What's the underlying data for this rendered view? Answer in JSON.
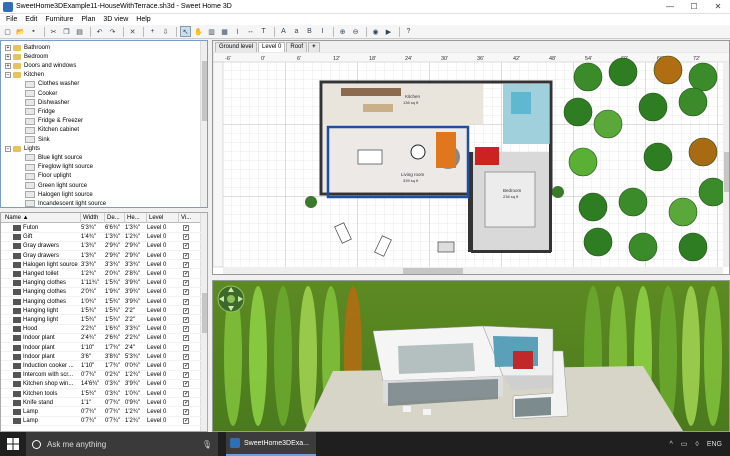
{
  "window": {
    "title": "SweetHome3DExample11-HouseWithTerrace.sh3d - Sweet Home 3D"
  },
  "menu": [
    "File",
    "Edit",
    "Furniture",
    "Plan",
    "3D view",
    "Help"
  ],
  "toolbar_icons": [
    "new-icon",
    "open-icon",
    "save-icon",
    "sep",
    "cut-icon",
    "copy-icon",
    "paste-icon",
    "sep",
    "undo-icon",
    "redo-icon",
    "sep",
    "delete-icon",
    "sep",
    "add-furniture-icon",
    "import-icon",
    "sep",
    "select-icon",
    "pan-icon",
    "create-walls-icon",
    "create-rooms-icon",
    "create-polylines-icon",
    "create-dimensions-icon",
    "create-labels-icon",
    "sep",
    "enlarge-text-icon",
    "reduce-text-icon",
    "bold-icon",
    "italic-icon",
    "sep",
    "zoom-in-icon",
    "zoom-out-icon",
    "sep",
    "create-photo-icon",
    "create-video-icon",
    "sep",
    "help-icon"
  ],
  "catalog": {
    "items": [
      {
        "label": "Bathroom",
        "level": 0,
        "kind": "folder",
        "expanded": false
      },
      {
        "label": "Bedroom",
        "level": 0,
        "kind": "folder",
        "expanded": false
      },
      {
        "label": "Doors and windows",
        "level": 0,
        "kind": "folder",
        "expanded": false
      },
      {
        "label": "Kitchen",
        "level": 0,
        "kind": "folder",
        "expanded": true
      },
      {
        "label": "Clothes washer",
        "level": 1,
        "kind": "item"
      },
      {
        "label": "Cooker",
        "level": 1,
        "kind": "item"
      },
      {
        "label": "Dishwasher",
        "level": 1,
        "kind": "item"
      },
      {
        "label": "Fridge",
        "level": 1,
        "kind": "item"
      },
      {
        "label": "Fridge & Freezer",
        "level": 1,
        "kind": "item"
      },
      {
        "label": "Kitchen cabinet",
        "level": 1,
        "kind": "item"
      },
      {
        "label": "Sink",
        "level": 1,
        "kind": "item"
      },
      {
        "label": "Lights",
        "level": 0,
        "kind": "folder",
        "expanded": true
      },
      {
        "label": "Blue light source",
        "level": 1,
        "kind": "item"
      },
      {
        "label": "Fireglow light source",
        "level": 1,
        "kind": "item"
      },
      {
        "label": "Floor uplight",
        "level": 1,
        "kind": "item"
      },
      {
        "label": "Green light source",
        "level": 1,
        "kind": "item"
      },
      {
        "label": "Halogen light source",
        "level": 1,
        "kind": "item"
      },
      {
        "label": "Incandescent light source",
        "level": 1,
        "kind": "item"
      }
    ]
  },
  "furniture": {
    "columns": [
      "Name ▲",
      "Width",
      "De...",
      "He...",
      "Level",
      "Vi..."
    ],
    "rows": [
      [
        "Futon",
        "5'3¾\"",
        "6'6¾\"",
        "1'3¾\"",
        "Level 0",
        "✓"
      ],
      [
        "Gift",
        "1'4¾\"",
        "1'3¾\"",
        "1'2¾\"",
        "Level 0",
        "✓"
      ],
      [
        "Gray drawers",
        "1'3¾\"",
        "2'9¾\"",
        "2'9¾\"",
        "Level 0",
        "✓"
      ],
      [
        "Gray drawers",
        "1'3¾\"",
        "2'9¾\"",
        "2'9¾\"",
        "Level 0",
        "✓"
      ],
      [
        "Halogen light source",
        "3'3¾\"",
        "3'3¾\"",
        "3'3¾\"",
        "Level 0",
        "✓"
      ],
      [
        "Hanged toilet",
        "1'2¾\"",
        "2'0¾\"",
        "2'8¾\"",
        "Level 0",
        "✓"
      ],
      [
        "Hanging clothes",
        "1'11¾\"",
        "1'5¾\"",
        "3'9¾\"",
        "Level 0",
        "✓"
      ],
      [
        "Hanging clothes",
        "2'0¾\"",
        "1'9¾\"",
        "3'9¾\"",
        "Level 0",
        "✓"
      ],
      [
        "Hanging clothes",
        "1'0¾\"",
        "1'5¾\"",
        "3'9¾\"",
        "Level 0",
        "✓"
      ],
      [
        "Hanging light",
        "1'5¾\"",
        "1'5¾\"",
        "2'2\"",
        "Level 0",
        "✓"
      ],
      [
        "Hanging light",
        "1'5¾\"",
        "1'5¾\"",
        "2'2\"",
        "Level 0",
        "✓"
      ],
      [
        "Hood",
        "2'2¾\"",
        "1'6¾\"",
        "3'3¾\"",
        "Level 0",
        "✓"
      ],
      [
        "Indoor plant",
        "2'4¾\"",
        "2'6¾\"",
        "2'2¾\"",
        "Level 0",
        "✓"
      ],
      [
        "Indoor plant",
        "1'10\"",
        "1'7¾\"",
        "2'4\"",
        "Level 0",
        "✓"
      ],
      [
        "Indoor plant",
        "3'6\"",
        "3'8¾\"",
        "5'3¾\"",
        "Level 0",
        "✓"
      ],
      [
        "Induction cooker ...",
        "1'10\"",
        "1'7¾\"",
        "0'0¾\"",
        "Level 0",
        "✓"
      ],
      [
        "Intercom with scr...",
        "0'7¾\"",
        "0'2¾\"",
        "1'2¾\"",
        "Level 0",
        "✓"
      ],
      [
        "Kitchen shop win...",
        "14'6¾\"",
        "0'3¾\"",
        "3'9¾\"",
        "Level 0",
        "✓"
      ],
      [
        "Kitchen tools",
        "1'5¾\"",
        "0'3¾\"",
        "1'0¾\"",
        "Level 0",
        "✓"
      ],
      [
        "Knife stand",
        "1'1\"",
        "0'7¾\"",
        "0'9¾\"",
        "Level 0",
        "✓"
      ],
      [
        "Lamp",
        "0'7¾\"",
        "0'7¾\"",
        "1'2¾\"",
        "Level 0",
        "✓"
      ],
      [
        "Lamp",
        "0'7¾\"",
        "0'7¾\"",
        "1'2¾\"",
        "Level 0",
        "✓"
      ]
    ]
  },
  "plan": {
    "tabs": [
      "Ground level",
      "Level 0",
      "Roof",
      "+"
    ],
    "selected_tab": "Level 0",
    "ruler": [
      "-6'",
      "0'",
      "6'",
      "12'",
      "18'",
      "24'",
      "30'",
      "36'",
      "42'",
      "48'",
      "54'",
      "60'",
      "66'",
      "72'"
    ],
    "rooms": [
      {
        "label": "Kitchen",
        "area": "136 sq ft"
      },
      {
        "label": "Living room",
        "area": "339 sq ft"
      },
      {
        "label": "Bedroom",
        "area": "236 sq ft"
      }
    ]
  },
  "taskbar": {
    "search_placeholder": "Ask me anything",
    "app_label": "SweetHome3DExa...",
    "tray": [
      "^",
      "▭",
      "◊",
      "ENG"
    ]
  }
}
